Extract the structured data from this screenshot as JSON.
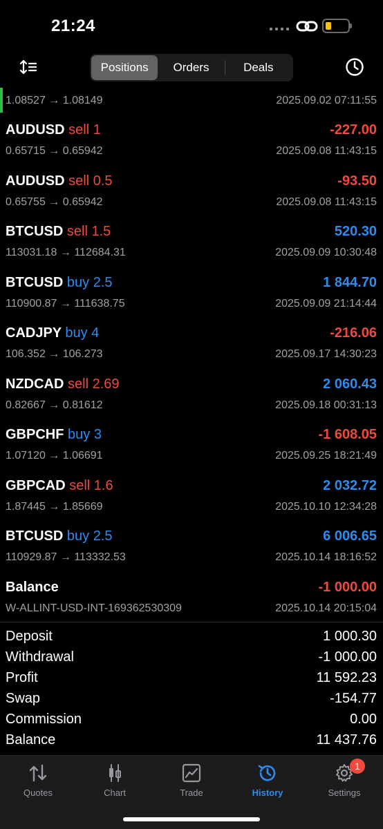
{
  "status_bar": {
    "time": "21:24"
  },
  "header": {
    "tabs": [
      {
        "label": "Positions",
        "active": true
      },
      {
        "label": "Orders",
        "active": false
      },
      {
        "label": "Deals",
        "active": false
      }
    ]
  },
  "partial_row": {
    "prices": "1.08527 → 1.08149",
    "datetime": "2025.09.02 07:11:55"
  },
  "deals": [
    {
      "symbol": "AUDUSD",
      "side": "sell 1",
      "side_type": "sell",
      "profit": "-227.00",
      "profit_sign": "neg",
      "prices": "0.65715 → 0.65942",
      "datetime": "2025.09.08 11:43:15"
    },
    {
      "symbol": "AUDUSD",
      "side": "sell 0.5",
      "side_type": "sell",
      "profit": "-93.50",
      "profit_sign": "neg",
      "prices": "0.65755 → 0.65942",
      "datetime": "2025.09.08 11:43:15"
    },
    {
      "symbol": "BTCUSD",
      "side": "sell 1.5",
      "side_type": "sell",
      "profit": "520.30",
      "profit_sign": "pos",
      "prices": "113031.18 → 112684.31",
      "datetime": "2025.09.09 10:30:48"
    },
    {
      "symbol": "BTCUSD",
      "side": "buy 2.5",
      "side_type": "buy",
      "profit": "1 844.70",
      "profit_sign": "pos",
      "prices": "110900.87 → 111638.75",
      "datetime": "2025.09.09 21:14:44"
    },
    {
      "symbol": "CADJPY",
      "side": "buy 4",
      "side_type": "buy",
      "profit": "-216.06",
      "profit_sign": "neg",
      "prices": "106.352 → 106.273",
      "datetime": "2025.09.17 14:30:23"
    },
    {
      "symbol": "NZDCAD",
      "side": "sell 2.69",
      "side_type": "sell",
      "profit": "2 060.43",
      "profit_sign": "pos",
      "prices": "0.82667 → 0.81612",
      "datetime": "2025.09.18 00:31:13"
    },
    {
      "symbol": "GBPCHF",
      "side": "buy 3",
      "side_type": "buy",
      "profit": "-1 608.05",
      "profit_sign": "neg",
      "prices": "1.07120 → 1.06691",
      "datetime": "2025.09.25 18:21:49"
    },
    {
      "symbol": "GBPCAD",
      "side": "sell 1.6",
      "side_type": "sell",
      "profit": "2 032.72",
      "profit_sign": "pos",
      "prices": "1.87445 → 1.85669",
      "datetime": "2025.10.10 12:34:28"
    },
    {
      "symbol": "BTCUSD",
      "side": "buy 2.5",
      "side_type": "buy",
      "profit": "6 006.65",
      "profit_sign": "pos",
      "prices": "110929.87 → 113332.53",
      "datetime": "2025.10.14 18:16:52"
    },
    {
      "symbol": "Balance",
      "side": "",
      "side_type": "",
      "profit": "-1 000.00",
      "profit_sign": "neg",
      "prices": "W-ALLINT-USD-INT-169362530309",
      "datetime": "2025.10.14 20:15:04"
    }
  ],
  "summary": [
    {
      "label": "Deposit",
      "value": "1 000.30"
    },
    {
      "label": "Withdrawal",
      "value": "-1 000.00"
    },
    {
      "label": "Profit",
      "value": "11 592.23"
    },
    {
      "label": "Swap",
      "value": "-154.77"
    },
    {
      "label": "Commission",
      "value": "0.00"
    },
    {
      "label": "Balance",
      "value": "11 437.76"
    }
  ],
  "tabbar": {
    "items": [
      {
        "label": "Quotes",
        "icon": "quotes-arrows-icon",
        "active": false
      },
      {
        "label": "Chart",
        "icon": "candlestick-icon",
        "active": false
      },
      {
        "label": "Trade",
        "icon": "trade-chart-icon",
        "active": false
      },
      {
        "label": "History",
        "icon": "history-clock-icon",
        "active": true
      },
      {
        "label": "Settings",
        "icon": "gear-icon",
        "active": false,
        "badge": "1"
      }
    ]
  },
  "colors": {
    "sell": "#f0493e",
    "buy": "#2d8cf0",
    "positive_profit": "#2d8cf0",
    "negative_profit": "#f0493e",
    "accent": "#2d8cf0",
    "marker_green": "#2dbd4a"
  }
}
